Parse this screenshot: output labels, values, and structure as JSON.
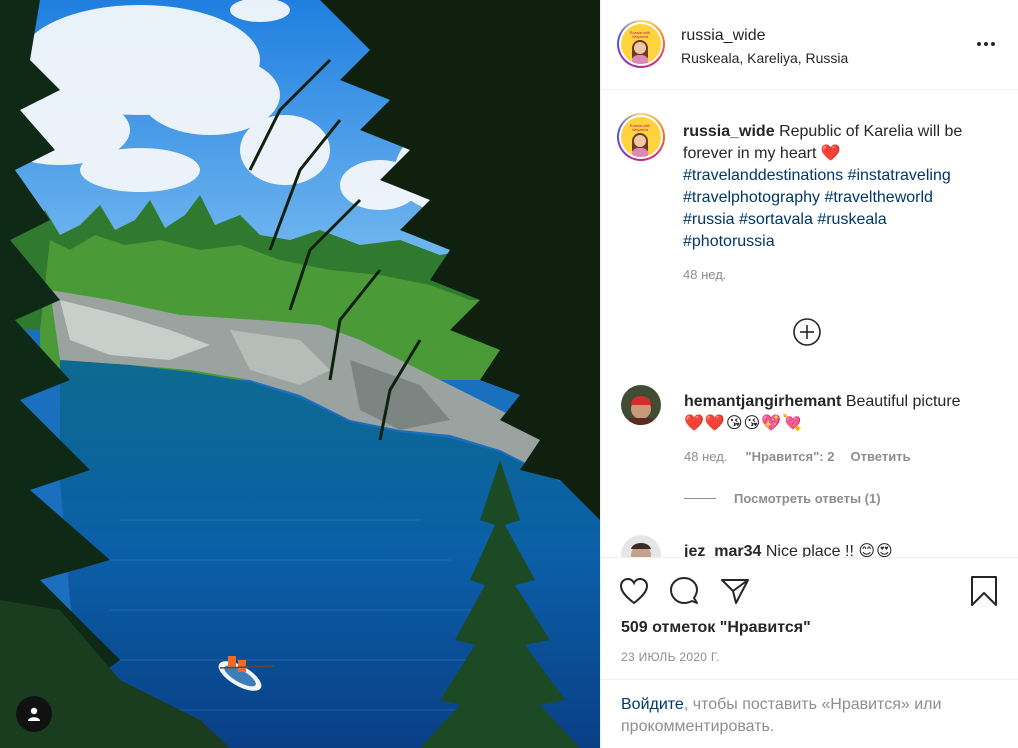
{
  "post": {
    "username": "russia_wide",
    "location": "Ruskeala, Kareliya, Russia",
    "avatar_caption": "Russia with Valyasha"
  },
  "caption": {
    "username": "russia_wide",
    "text": "Republic of Karelia will be forever in my heart",
    "heart": "❤️",
    "hashtags": [
      "#travelanddestinations",
      "#instatraveling",
      "#travelphotography",
      "#traveltheworld",
      "#russia",
      "#sortavala",
      "#ruskeala",
      "#photorussia"
    ],
    "time": "48 нед."
  },
  "comments": [
    {
      "username": "hemantjangirhemant",
      "text": "Beautiful picture",
      "emoji": "❤️❤️😘😘💖💘",
      "time": "48 нед.",
      "likes": "\"Нравится\": 2",
      "reply": "Ответить",
      "view_replies": "Посмотреть ответы (1)"
    },
    {
      "username": "jez_mar34",
      "text": "Nice place !!",
      "emoji": "😊😍"
    }
  ],
  "actions": {
    "likes_count": "509 отметок \"Нравится\"",
    "date": "23 ИЮЛЬ 2020 Г."
  },
  "login_prompt": {
    "link": "Войдите",
    "rest": ", чтобы поставить «Нравится» или прокомментировать."
  },
  "icons": {
    "like": "heart-outline-icon",
    "comment": "speech-bubble-icon",
    "share": "paper-plane-icon",
    "save": "bookmark-icon",
    "more": "ellipsis-icon",
    "load_more": "plus-circle-icon",
    "user_tags": "person-icon"
  },
  "colors": {
    "text": "#262626",
    "muted": "#8e8e8e",
    "link": "#00376b",
    "border": "#efefef"
  }
}
